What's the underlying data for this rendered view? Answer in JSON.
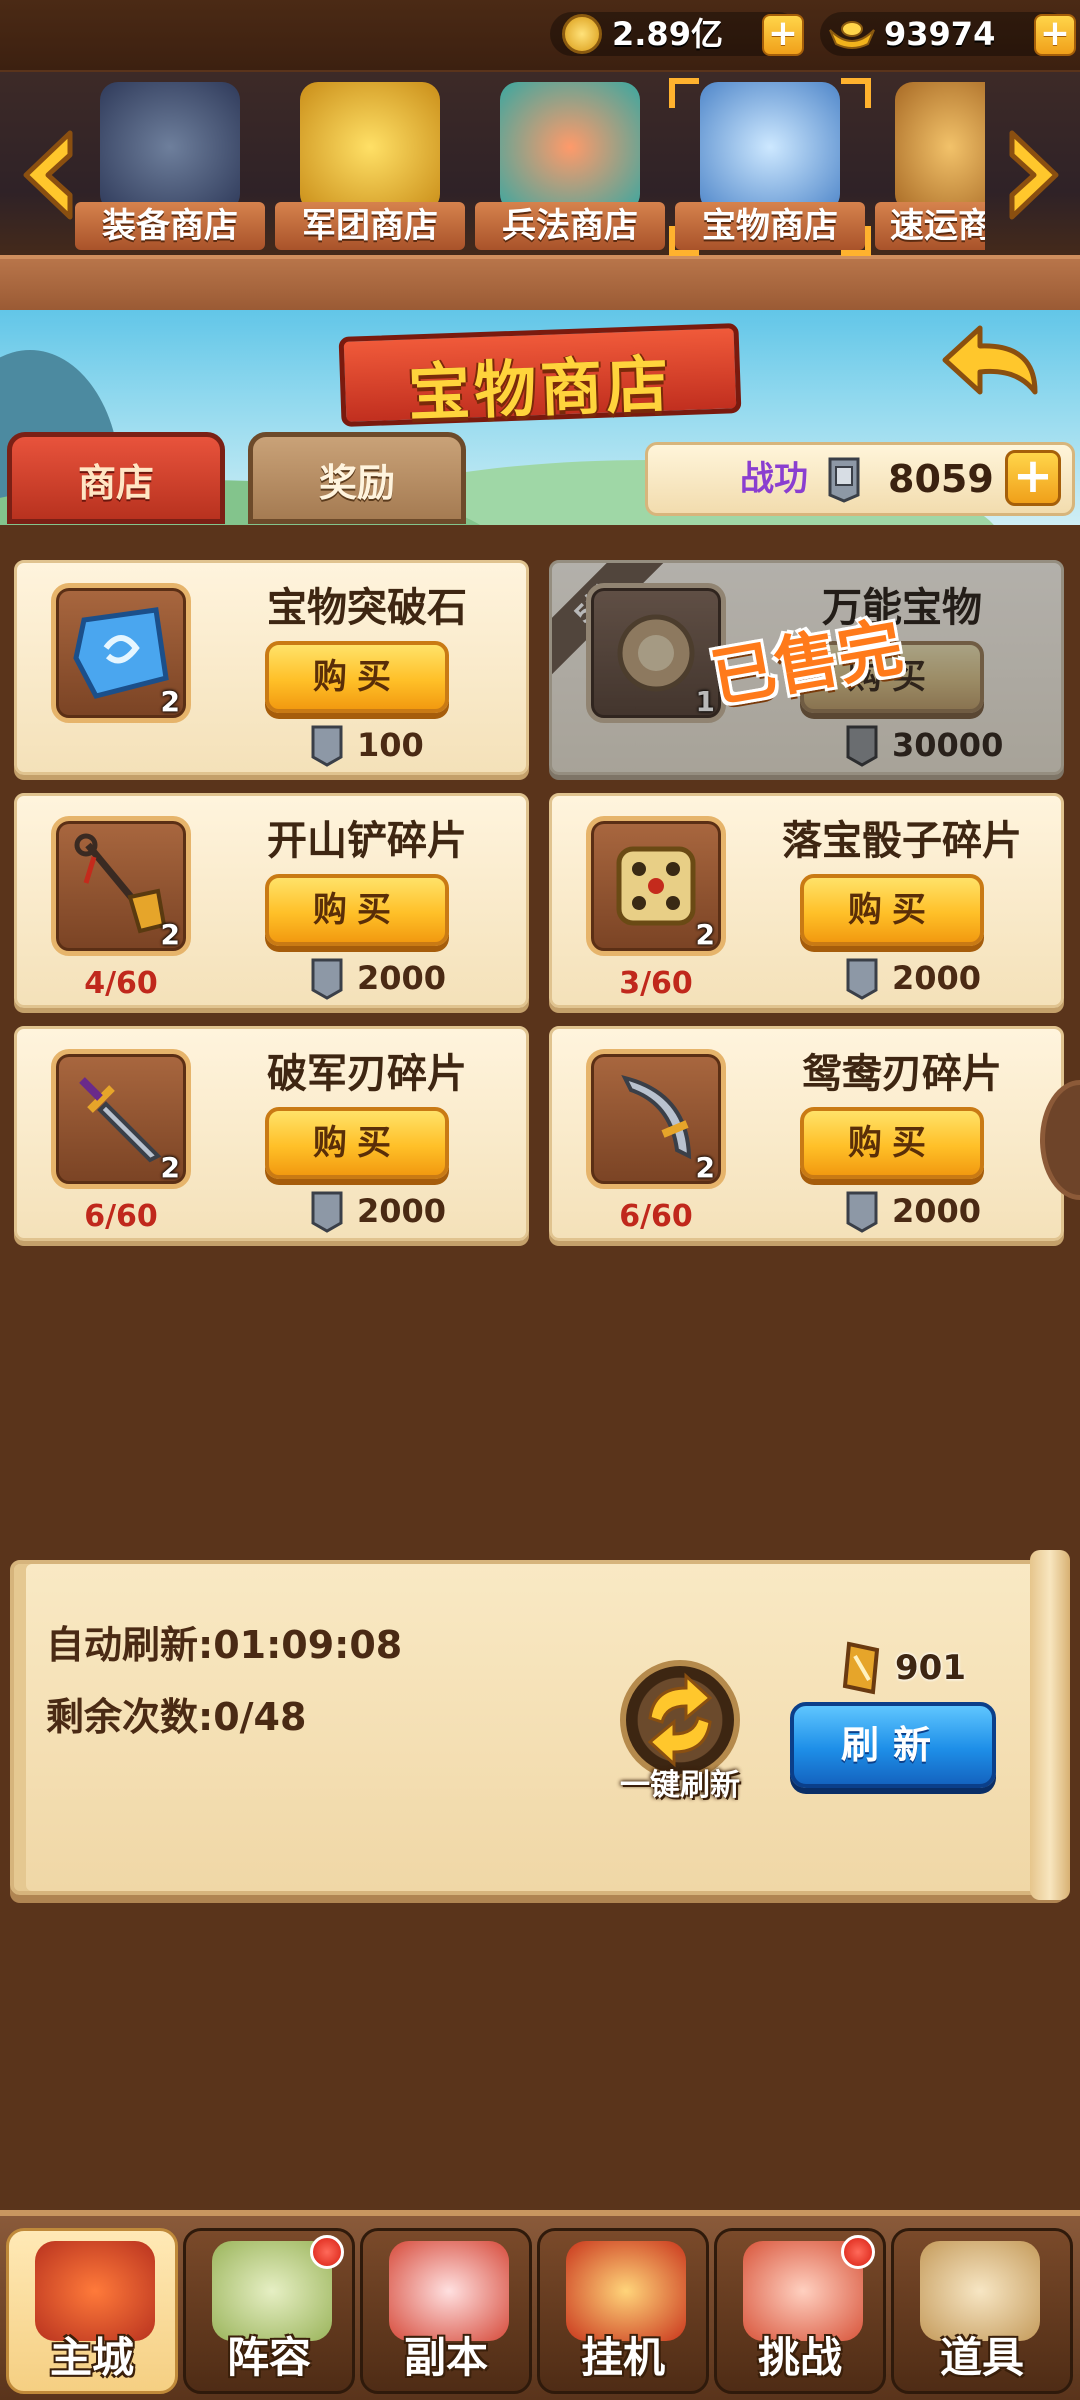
{
  "currency": {
    "gold": "2.89亿",
    "ingots": "93974"
  },
  "shops": [
    {
      "label": "装备商店",
      "icon": "armor-helmet-icon"
    },
    {
      "label": "军团商店",
      "icon": "gold-ingot-icon"
    },
    {
      "label": "兵法商店",
      "icon": "strategy-book-icon"
    },
    {
      "label": "宝物商店",
      "icon": "treasure-stone-icon",
      "active": true
    },
    {
      "label": "速运商",
      "icon": "cargo-crate-icon"
    }
  ],
  "title": "宝物商店",
  "tabs": {
    "shop": "商店",
    "reward": "奖励"
  },
  "merit": {
    "label": "战功",
    "value": "8059"
  },
  "buy_label": "购买",
  "items": [
    {
      "name": "宝物突破石",
      "count": "2",
      "price": "100",
      "progress": "",
      "icon": "breakthrough-stone-icon"
    },
    {
      "name": "万能宝物",
      "count": "1",
      "price": "30000",
      "progress": "",
      "icon": "universal-treasure-icon",
      "discount": "5折",
      "soldout": "已售完"
    },
    {
      "name": "开山铲碎片",
      "count": "2",
      "price": "2000",
      "progress": "4/60",
      "icon": "shovel-icon"
    },
    {
      "name": "落宝骰子碎片",
      "count": "2",
      "price": "2000",
      "progress": "3/60",
      "icon": "dice-icon"
    },
    {
      "name": "破军刃碎片",
      "count": "2",
      "price": "2000",
      "progress": "6/60",
      "icon": "sword-icon"
    },
    {
      "name": "鸳鸯刃碎片",
      "count": "2",
      "price": "2000",
      "progress": "6/60",
      "icon": "curved-blade-icon"
    }
  ],
  "refresh": {
    "auto_label": "自动刷新:",
    "auto_time": "01:09:08",
    "remain_label": "剩余次数:",
    "remain_value": "0/48",
    "oneclick_label": "一键刷新",
    "token_count": "901",
    "button_label": "刷新"
  },
  "nav": [
    {
      "label": "主城",
      "active": true,
      "badge": false
    },
    {
      "label": "阵容",
      "badge": true
    },
    {
      "label": "副本",
      "badge": false
    },
    {
      "label": "挂机",
      "badge": false
    },
    {
      "label": "挑战",
      "badge": true
    },
    {
      "label": "道具",
      "badge": false
    }
  ],
  "colors": {
    "accent_gold": "#ffc028",
    "refresh_blue": "#1e8fe8",
    "merit_purple": "#8a3ed0",
    "progress_red": "#c0281c"
  }
}
